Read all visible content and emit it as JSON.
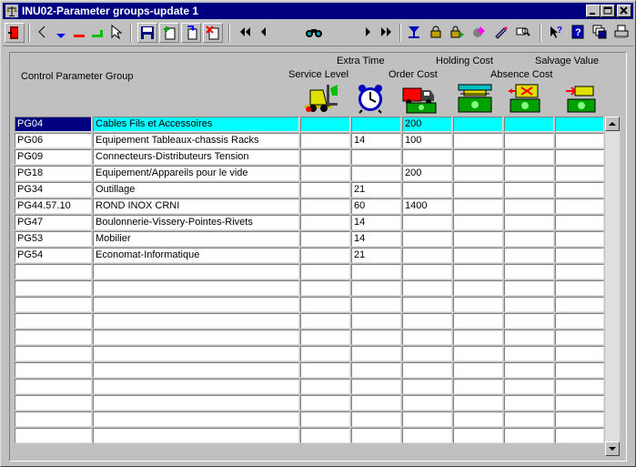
{
  "window": {
    "title": "INU02-Parameter groups-update 1"
  },
  "toolbar": {
    "icons": [
      "exit-icon",
      "nav-prev-icon",
      "insert-row-icon",
      "delete-row-icon",
      "clear-row-icon",
      "cursor-icon",
      "save-icon",
      "add-record-icon",
      "duplicate-record-icon",
      "delete-record-icon",
      "first-record-icon",
      "prev-record-icon",
      "search-binoculars-icon",
      "next-record-icon",
      "last-record-icon",
      "filter-icon",
      "lock-icon",
      "lock-next-icon",
      "edit-icon",
      "edit-pencil-icon",
      "zoom-icon",
      "context-help-icon",
      "help-book-icon",
      "windows-icon",
      "print-icon"
    ]
  },
  "headers": {
    "group": "Control Parameter Group",
    "service_level": "Service Level",
    "extra_time": "Extra Time",
    "order_cost": "Order Cost",
    "holding_cost": "Holding Cost",
    "absence_cost": "Absence Cost",
    "salvage_value": "Salvage Value"
  },
  "rows": [
    {
      "code": "PG04",
      "name": "Cables Fils et Accessoires",
      "service": "",
      "extra": "",
      "order": "200",
      "holding": "",
      "absence": "",
      "salvage": "",
      "selected": true
    },
    {
      "code": "PG06",
      "name": "Equipement Tableaux-chassis Racks",
      "service": "",
      "extra": "14",
      "order": "100",
      "holding": "",
      "absence": "",
      "salvage": ""
    },
    {
      "code": "PG09",
      "name": "Connecteurs-Distributeurs Tension",
      "service": "",
      "extra": "",
      "order": "",
      "holding": "",
      "absence": "",
      "salvage": ""
    },
    {
      "code": "PG18",
      "name": "Equipement/Appareils pour le vide",
      "service": "",
      "extra": "",
      "order": "200",
      "holding": "",
      "absence": "",
      "salvage": ""
    },
    {
      "code": "PG34",
      "name": "Outillage",
      "service": "",
      "extra": "21",
      "order": "",
      "holding": "",
      "absence": "",
      "salvage": ""
    },
    {
      "code": "PG44.57.10",
      "name": "ROND INOX CRNI",
      "service": "",
      "extra": "60",
      "order": "1400",
      "holding": "",
      "absence": "",
      "salvage": ""
    },
    {
      "code": "PG47",
      "name": "Boulonnerie-Vissery-Pointes-Rivets",
      "service": "",
      "extra": "14",
      "order": "",
      "holding": "",
      "absence": "",
      "salvage": ""
    },
    {
      "code": "PG53",
      "name": "Mobilier",
      "service": "",
      "extra": "14",
      "order": "",
      "holding": "",
      "absence": "",
      "salvage": ""
    },
    {
      "code": "PG54",
      "name": "Economat-Informatique",
      "service": "",
      "extra": "21",
      "order": "",
      "holding": "",
      "absence": "",
      "salvage": ""
    }
  ],
  "empty_row_count": 11,
  "colors": {
    "titlebar": "#000080",
    "selected_row": "#00ffff",
    "selected_cell": "#000080"
  }
}
